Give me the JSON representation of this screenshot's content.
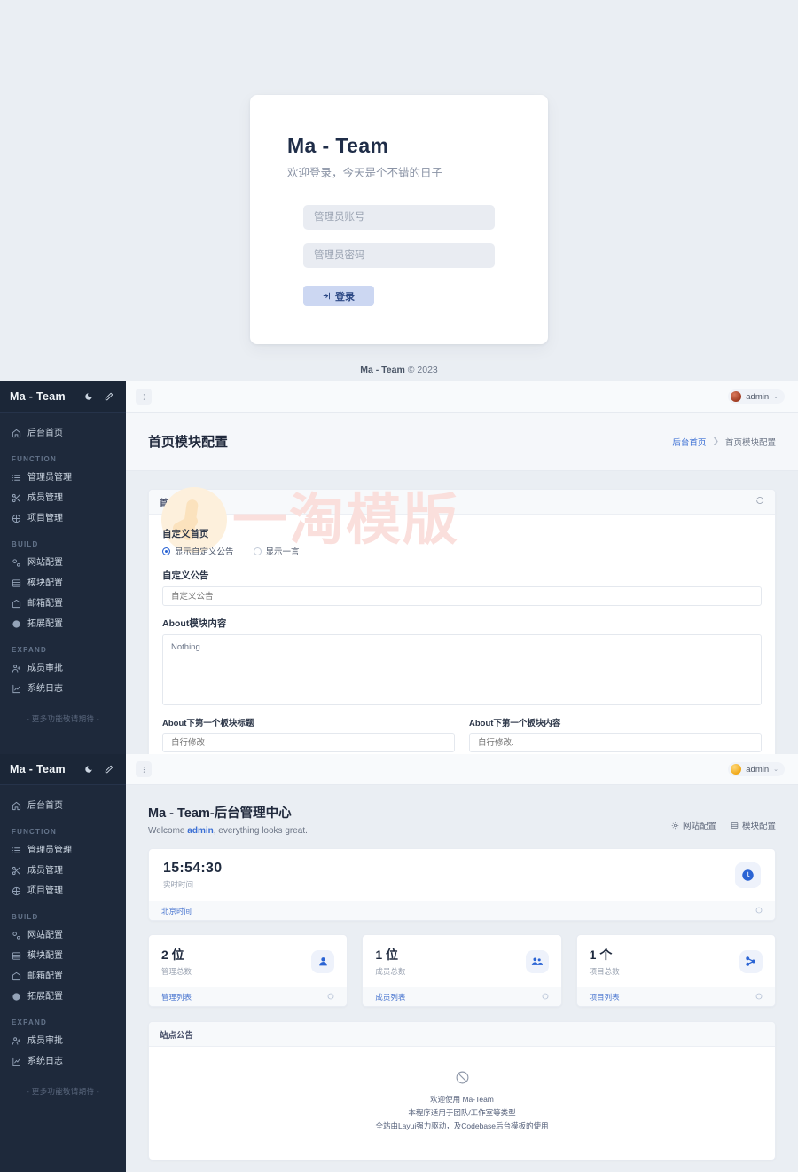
{
  "login": {
    "title": "Ma - Team",
    "subtitle": "欢迎登录，今天是个不错的日子",
    "account_placeholder": "管理员账号",
    "password_placeholder": "管理员密码",
    "submit_label": "登录",
    "footer_brand": "Ma - Team",
    "footer_copy": "© 2023"
  },
  "sidebar": {
    "logo": "Ma - Team",
    "dark_mode_icon": "moon-icon",
    "theme_icon": "pencil-icon",
    "home": {
      "label": "后台首页",
      "icon": "home-icon"
    },
    "groups": [
      {
        "label": "FUNCTION",
        "items": [
          {
            "label": "管理员管理",
            "icon": "list-icon"
          },
          {
            "label": "成员管理",
            "icon": "scissors-icon"
          },
          {
            "label": "项目管理",
            "icon": "cube-icon"
          }
        ]
      },
      {
        "label": "BUILD",
        "items": [
          {
            "label": "网站配置",
            "icon": "settings-icon"
          },
          {
            "label": "模块配置",
            "icon": "grid-icon"
          },
          {
            "label": "邮箱配置",
            "icon": "mail-icon"
          },
          {
            "label": "拓展配置",
            "icon": "disc-icon"
          }
        ]
      },
      {
        "label": "EXPAND",
        "items": [
          {
            "label": "成员审批",
            "icon": "user-plus-icon"
          },
          {
            "label": "系统日志",
            "icon": "chart-icon"
          }
        ]
      }
    ],
    "more_text": "- 更多功能敬请期待 -"
  },
  "panel2": {
    "topbar": {
      "menu_icon": "more-vertical-icon",
      "user": "admin",
      "avatar": "brown",
      "caret": "⌄"
    },
    "page_title": "首页模块配置",
    "breadcrumb": {
      "root": "后台首页",
      "sep": "❯",
      "current": "首页模块配置"
    },
    "card": {
      "title": "首页模块设置",
      "refresh_icon": "refresh-icon"
    },
    "form": {
      "custom_home_label": "自定义首页",
      "radio_custom": "显示自定义公告",
      "radio_hitokoto": "显示一言",
      "notice_label": "自定义公告",
      "notice_placeholder": "自定义公告",
      "about_label": "About模块内容",
      "about_value": "Nothing",
      "block1_title_label": "About下第一个板块标题",
      "block1_title_value": "自行修改",
      "block1_body_label": "About下第一个板块内容",
      "block1_body_value": "自行修改."
    },
    "watermark": "一淘模版"
  },
  "panel3": {
    "topbar": {
      "menu_icon": "more-vertical-icon",
      "user": "admin",
      "avatar": "gold",
      "caret": "⌄"
    },
    "title": "Ma - Team-后台管理中心",
    "welcome_pre": "Welcome ",
    "welcome_user": "admin",
    "welcome_post": ", everything looks great.",
    "actions": [
      {
        "label": "网站配置",
        "icon": "gear-icon"
      },
      {
        "label": "模块配置",
        "icon": "grid-icon"
      }
    ],
    "time_card": {
      "value": "15:54:30",
      "label": "实时时间",
      "icon": "clock-icon",
      "foot_link": "北京时间",
      "foot_icon": "circle-icon"
    },
    "stats": [
      {
        "value": "2 位",
        "label": "管理总数",
        "icon": "user-icon",
        "foot_link": "管理列表",
        "foot_icon": "circle-icon"
      },
      {
        "value": "1 位",
        "label": "成员总数",
        "icon": "users-icon",
        "foot_link": "成员列表",
        "foot_icon": "circle-icon"
      },
      {
        "value": "1 个",
        "label": "项目总数",
        "icon": "share-icon",
        "foot_link": "项目列表",
        "foot_icon": "circle-icon"
      }
    ],
    "notice": {
      "title": "站点公告",
      "icon": "no-data-icon",
      "lines": [
        "欢迎使用 Ma-Team",
        "本程序适用于团队/工作室等类型",
        "全站由Layui强力驱动，及Codebase后台模板的使用"
      ]
    }
  }
}
